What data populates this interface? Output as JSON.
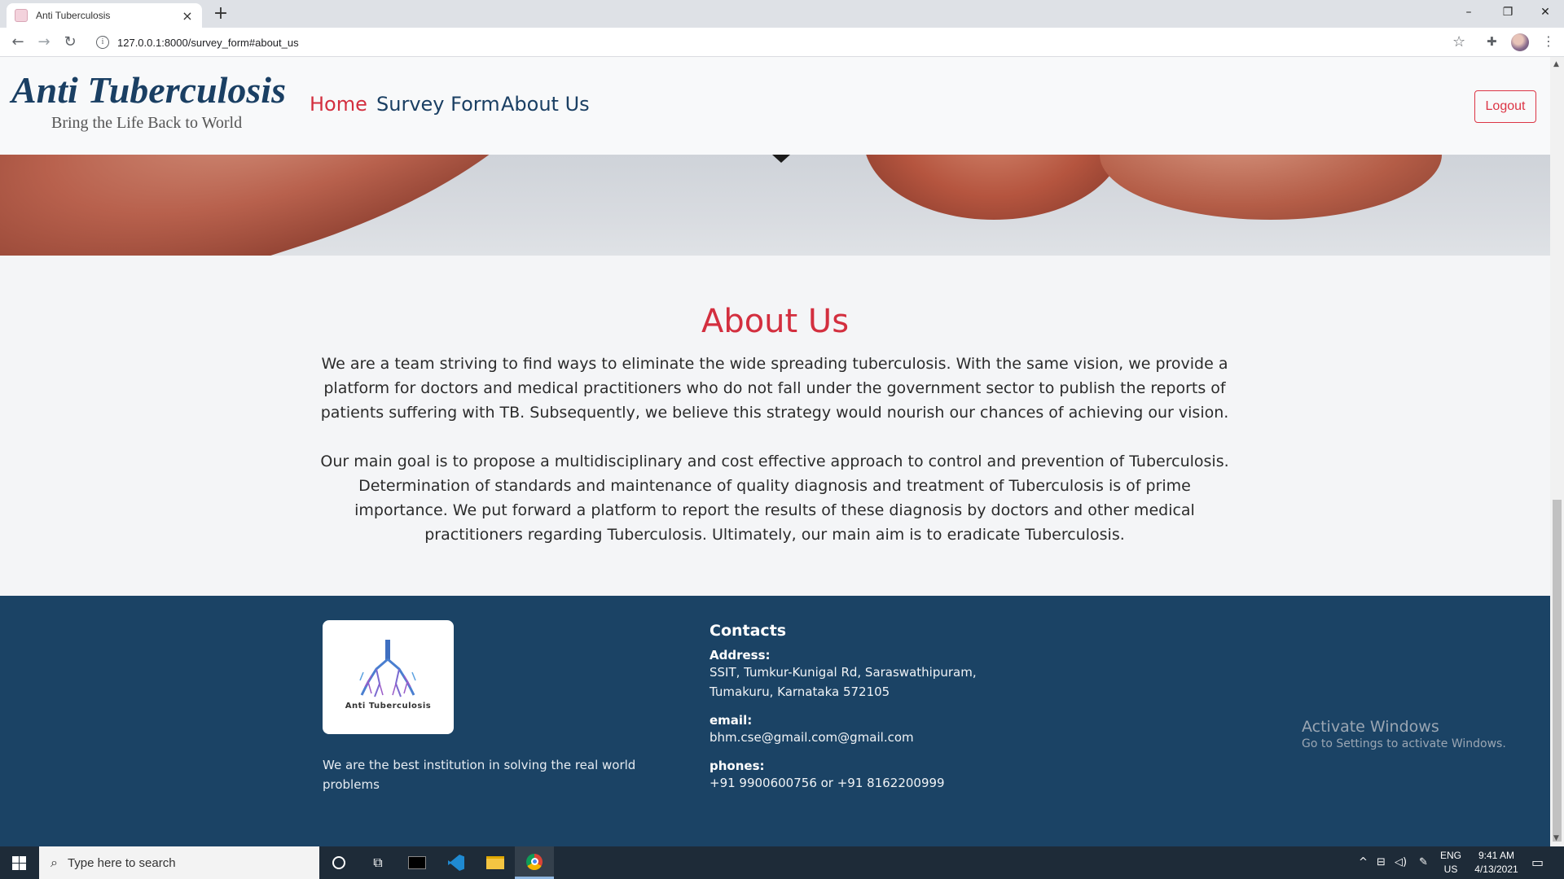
{
  "browser": {
    "tab_title": "Anti Tuberculosis",
    "tab_close": "×",
    "new_tab": "+",
    "url": "127.0.0.1:8000/survey_form#about_us",
    "window_controls": [
      "–",
      "❐",
      "✕"
    ]
  },
  "navbar": {
    "brand_title": "Anti Tuberculosis",
    "brand_subtitle": "Bring the Life Back to World",
    "links": [
      {
        "label": "Home",
        "active": true
      },
      {
        "label": "Survey Form",
        "active": false
      },
      {
        "label": "About Us",
        "active": false
      }
    ],
    "logout_label": "Logout"
  },
  "about": {
    "heading": "About Us",
    "paragraph1": "We are a team striving to find ways to eliminate the wide spreading tuberculosis. With the same vision, we provide a platform for doctors and medical practitioners who do not fall under the government sector to publish the reports of patients suffering with TB. Subsequently, we believe this strategy would nourish our chances of achieving our vision.",
    "paragraph2": "Our main goal is to propose a multidisciplinary and cost effective approach to control and prevention of Tuberculosis. Determination of standards and maintenance of quality diagnosis and treatment of Tuberculosis is of prime importance. We put forward a platform to report the results of these diagnosis by doctors and other medical practitioners regarding Tuberculosis. Ultimately, our main aim is to eradicate Tuberculosis."
  },
  "footer": {
    "logo_text": "Anti Tuberculosis",
    "description": "We are the best institution in solving the real world problems",
    "contacts_heading": "Contacts",
    "address_label": "Address:",
    "address_line1": "SSIT, Tumkur-Kunigal Rd, Saraswathipuram,",
    "address_line2": "Tumakuru, Karnataka 572105",
    "email_label": "email:",
    "email_value": "bhm.cse@gmail.com@gmail.com",
    "phones_label": "phones:",
    "phones_value": "+91 9900600756 or +91 8162200999"
  },
  "watermark": {
    "line1": "Activate Windows",
    "line2": "Go to Settings to activate Windows."
  },
  "taskbar": {
    "search_placeholder": "Type here to search",
    "lang_line1": "ENG",
    "lang_line2": "US",
    "time": "9:41 AM",
    "date": "4/13/2021"
  },
  "colors": {
    "brand_navy": "#1a3f63",
    "accent_red": "#d32f3f",
    "footer_bg": "#1b4365"
  }
}
